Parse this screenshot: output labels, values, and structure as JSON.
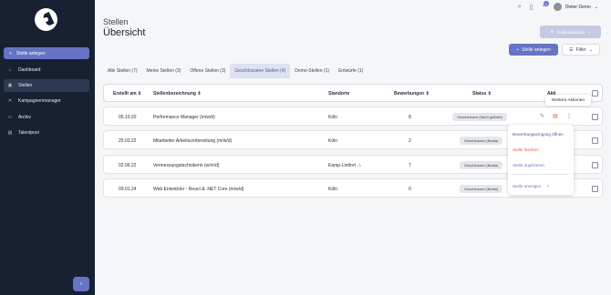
{
  "sidebar": {
    "create_label": "Stelle anlegen",
    "items": [
      {
        "label": "Dashboard",
        "icon": "home-icon"
      },
      {
        "label": "Stellen",
        "icon": "briefcase-icon"
      },
      {
        "label": "Kampagnenmanager",
        "icon": "tools-icon"
      },
      {
        "label": "Archiv",
        "icon": "archive-icon"
      },
      {
        "label": "Talentpool",
        "icon": "folder-icon"
      }
    ],
    "collapse_glyph": "‹"
  },
  "topbar": {
    "notification_count": "0",
    "user_name": "Dieter Demo"
  },
  "page": {
    "subtitle": "Stellen",
    "title": "Übersicht",
    "actions_label": "Stellenaktionen",
    "create_label": "Stelle anlegen",
    "filter_label": "Filter"
  },
  "tabs": [
    {
      "label": "Alle Stellen (7)"
    },
    {
      "label": "Meine Stellen (3)"
    },
    {
      "label": "Offene Stellen (3)"
    },
    {
      "label": "Geschlossene Stellen (4)"
    },
    {
      "label": "Demo-Stellen (1)"
    },
    {
      "label": "Entwürfe (1)"
    }
  ],
  "table": {
    "headers": {
      "created": "Erstellt am ⇕",
      "name": "Stellenbezeichnung ⇕",
      "location": "Standorte",
      "applications": "Bewerbungen ⇕",
      "status": "Status ⇕",
      "actions": "Akti"
    },
    "rows": [
      {
        "created": "05.10.20",
        "name": "Performance Manager (m/w/d)",
        "location": "Köln",
        "applications": "8",
        "status": "Geschlossen (Nicht gelistet)",
        "warn": ""
      },
      {
        "created": "25.03.22",
        "name": "Mitarbeiter Arbeitsvorbereitung (m/w/d)",
        "location": "Köln",
        "applications": "2",
        "status": "Geschlossen (Bosta)",
        "warn": ""
      },
      {
        "created": "02.06.22",
        "name": "Vermessungstechnikerin (w/m/d)",
        "location": "Kamp-Lintfort",
        "applications": "7",
        "status": "Geschlossen (Bosta)",
        "warn": "⚠"
      },
      {
        "created": "09.01.24",
        "name": "Web Entwickler - React & .NET Core (m/w/d)",
        "location": "Köln",
        "applications": "0",
        "status": "Geschlossen (Bosta)",
        "warn": ""
      }
    ]
  },
  "tooltip": "Weitere Aktionen",
  "menu": {
    "open_process": "Bewerbungseingang öffnen",
    "delete": "Stelle löschen",
    "duplicate": "Stelle duplizieren",
    "show": "Stelle anzeigen"
  },
  "colors": {
    "sidebar_bg": "#172132",
    "accent": "#6574c4",
    "danger": "#e05a4e"
  }
}
